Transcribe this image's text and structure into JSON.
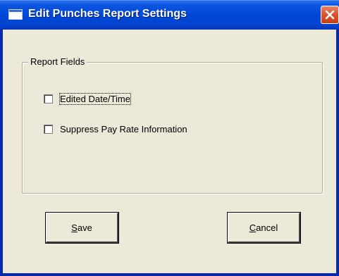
{
  "window": {
    "title": "Edit Punches Report Settings",
    "close_icon": "close-icon"
  },
  "group": {
    "legend": "Report Fields"
  },
  "checkboxes": [
    {
      "label": "Edited Date/Time",
      "checked": false
    },
    {
      "label": "Suppress Pay Rate Information",
      "checked": false
    }
  ],
  "buttons": {
    "save": {
      "mnemonic": "S",
      "rest": "ave"
    },
    "cancel": {
      "mnemonic": "C",
      "rest": "ancel"
    }
  },
  "colors": {
    "titlebar": "#0047d6",
    "dialog_bg": "#ece9d8",
    "close_button": "#d9542b"
  }
}
